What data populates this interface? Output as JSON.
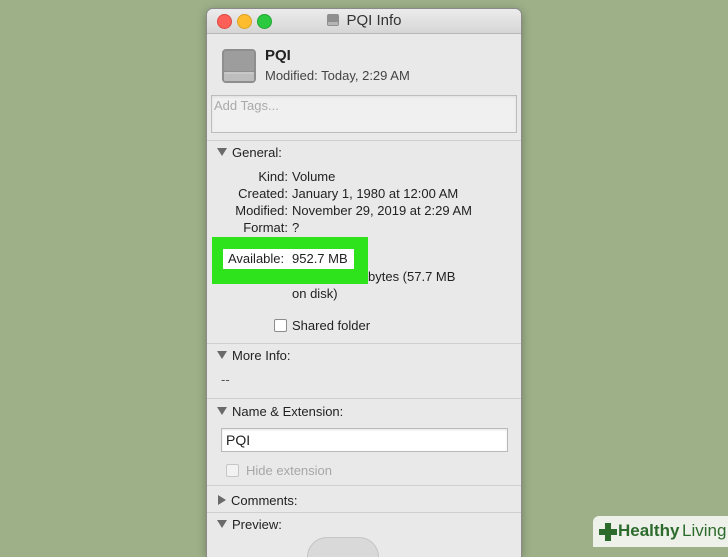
{
  "window": {
    "title": "PQI Info"
  },
  "header": {
    "name": "PQI",
    "modified_label": "Modified:",
    "modified_value": "Today, 2:29 AM",
    "icon": "drive-icon"
  },
  "tags": {
    "placeholder": "Add Tags..."
  },
  "general": {
    "title": "General:",
    "rows": [
      {
        "key": "Kind:",
        "value": "Volume"
      },
      {
        "key": "Created:",
        "value": "January 1, 1980 at 12:00 AM"
      },
      {
        "key": "Modified:",
        "value": "November 29, 2019 at 2:29 AM"
      },
      {
        "key": "Format:",
        "value": "?"
      }
    ],
    "available_label": "Available:",
    "available_value": "952.7 MB",
    "size_partial": "bytes (57.7 MB",
    "size_partial2": "on disk)",
    "shared_folder": "Shared folder",
    "shared_checked": false,
    "highlight_color": "#2ee31c"
  },
  "more_info": {
    "title": "More Info:",
    "value": "--"
  },
  "name_extension": {
    "title": "Name & Extension:",
    "name_value": "PQI",
    "hide_extension": "Hide extension",
    "hide_checked": false
  },
  "comments": {
    "title": "Comments:"
  },
  "preview": {
    "title": "Preview:"
  },
  "watermark": {
    "brand_bold": "Healthy",
    "brand_light": "Living",
    "color": "#2d6b2d"
  }
}
